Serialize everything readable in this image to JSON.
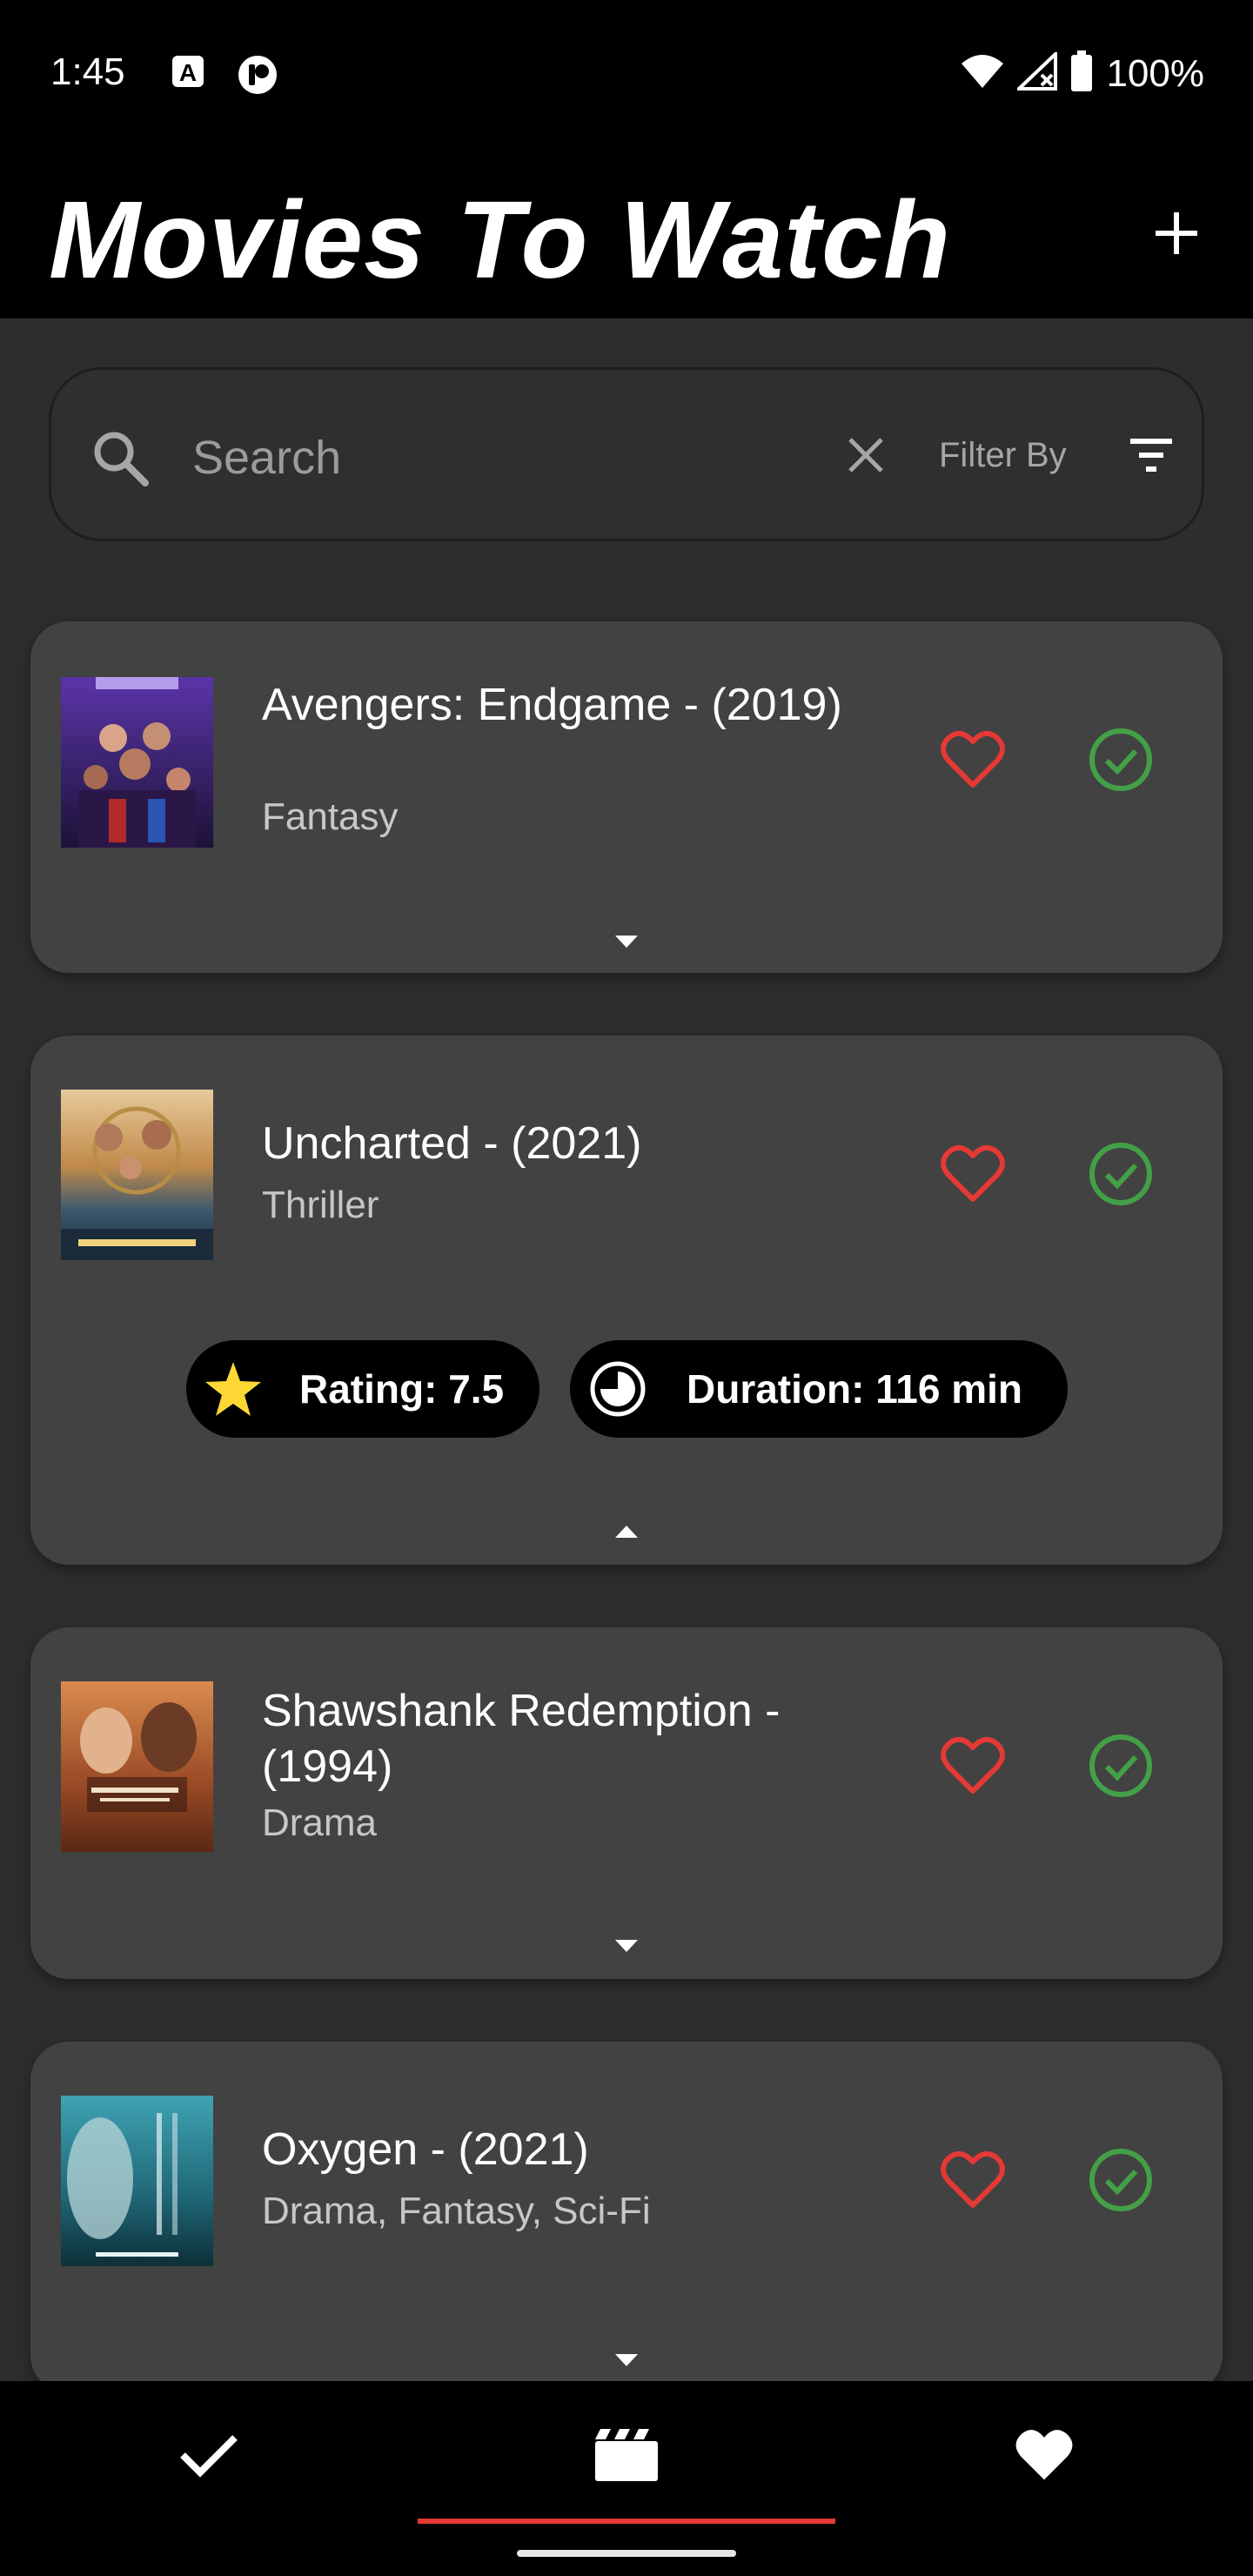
{
  "status_bar": {
    "time": "1:45",
    "battery": "100%",
    "icons": [
      "a-notification-icon",
      "app-notification-icon",
      "wifi-icon",
      "signal-icon",
      "battery-icon"
    ]
  },
  "header": {
    "title": "Movies To Watch",
    "add_icon": "plus-icon"
  },
  "search": {
    "placeholder": "Search",
    "value": "",
    "filter_label": "Filter By"
  },
  "movies": [
    {
      "title": "Avengers: Endgame - (2019)",
      "genre": "Fantasy",
      "expanded": false
    },
    {
      "title": "Uncharted - (2021)",
      "genre": "Thriller",
      "expanded": true,
      "rating": "Rating: 7.5",
      "duration": "Duration: 116 min"
    },
    {
      "title": "Shawshank Redemption - (1994)",
      "genre": "Drama",
      "expanded": false
    },
    {
      "title": "Oxygen - (2021)",
      "genre": "Drama, Fantasy, Sci-Fi",
      "expanded": false
    }
  ],
  "bottom_nav": {
    "items": [
      "watched-check-icon",
      "movies-clapper-icon",
      "favorites-heart-icon"
    ],
    "active_index": 1
  },
  "colors": {
    "favorite": "#e53935",
    "watched": "#43a047",
    "star": "#fdd835",
    "accent": "#e53935"
  }
}
